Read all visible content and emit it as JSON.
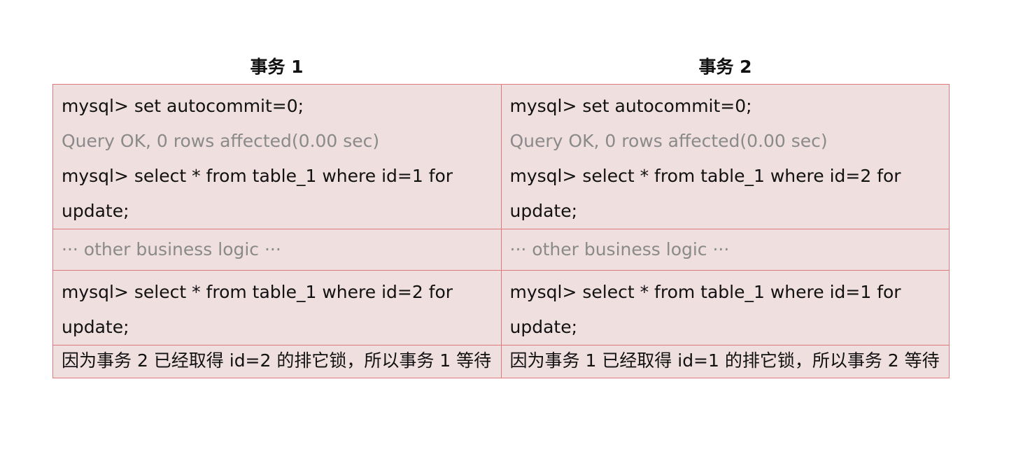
{
  "headers": [
    "事务 1",
    "事务 2"
  ],
  "rows": [
    {
      "tx1": [
        "mysql> set autocommit=0;",
        "Query OK, 0 rows affected(0.00 sec)",
        "mysql> select * from table_1 where id=1 for",
        "update;"
      ],
      "tx2": [
        "mysql> set autocommit=0;",
        "Query OK, 0 rows affected(0.00 sec)",
        "mysql> select * from table_1 where id=2 for",
        "update;"
      ]
    },
    {
      "tx1": [
        "··· other business logic ···"
      ],
      "tx2": [
        "··· other business logic ···"
      ]
    },
    {
      "tx1": [
        "mysql> select * from table_1 where id=2 for",
        "update;"
      ],
      "tx2": [
        "mysql> select * from table_1 where id=1 for",
        "update;"
      ]
    },
    {
      "tx1": "因为事务 2 已经取得 id=2 的排它锁，所以事务 1 等待",
      "tx2": "因为事务 1 已经取得 id=1 的排它锁，所以事务 2 等待"
    }
  ]
}
